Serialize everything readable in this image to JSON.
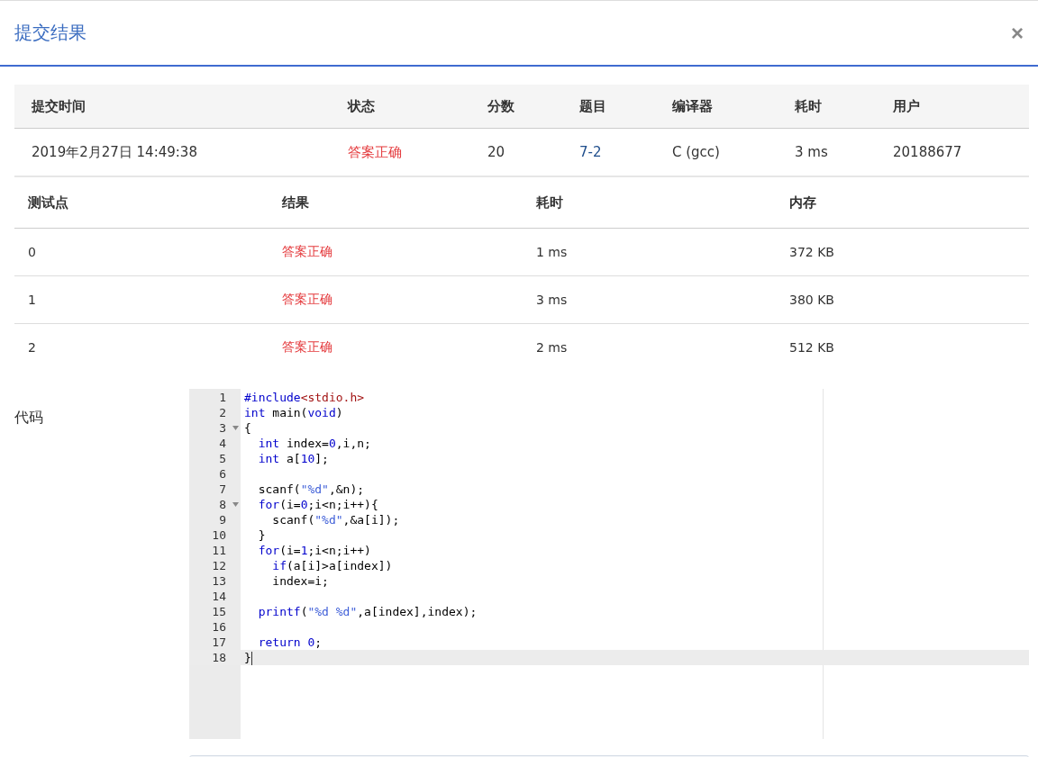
{
  "dialog": {
    "title": "提交结果",
    "close": "×"
  },
  "submission": {
    "columns": [
      "提交时间",
      "状态",
      "分数",
      "题目",
      "编译器",
      "耗时",
      "用户"
    ],
    "row": {
      "time": "2019年2月27日 14:49:38",
      "status": "答案正确",
      "score": "20",
      "problem": "7-2",
      "compiler": "C (gcc)",
      "duration": "3 ms",
      "user": "20188677"
    }
  },
  "tests": {
    "columns": [
      "测试点",
      "结果",
      "耗时",
      "内存"
    ],
    "rows": [
      {
        "case": "0",
        "result": "答案正确",
        "duration": "1 ms",
        "memory": "372 KB"
      },
      {
        "case": "1",
        "result": "答案正确",
        "duration": "3 ms",
        "memory": "380 KB"
      },
      {
        "case": "2",
        "result": "答案正确",
        "duration": "2 ms",
        "memory": "512 KB"
      }
    ]
  },
  "code": {
    "label": "代码",
    "lines": [
      {
        "number": "1",
        "foldable": false,
        "selected": false,
        "tokens": [
          {
            "kind": "keyword",
            "text": "#include"
          },
          {
            "kind": "header",
            "text": "<stdio.h>"
          }
        ]
      },
      {
        "number": "2",
        "foldable": false,
        "selected": false,
        "tokens": [
          {
            "kind": "keyword",
            "text": "int"
          },
          {
            "kind": "plain",
            "text": " main("
          },
          {
            "kind": "keyword",
            "text": "void"
          },
          {
            "kind": "plain",
            "text": ")"
          }
        ]
      },
      {
        "number": "3",
        "foldable": true,
        "selected": false,
        "tokens": [
          {
            "kind": "plain",
            "text": "{"
          }
        ]
      },
      {
        "number": "4",
        "foldable": false,
        "selected": false,
        "tokens": [
          {
            "kind": "keyword",
            "text": "  int"
          },
          {
            "kind": "plain",
            "text": " index="
          },
          {
            "kind": "number",
            "text": "0"
          },
          {
            "kind": "plain",
            "text": ",i,n;"
          }
        ]
      },
      {
        "number": "5",
        "foldable": false,
        "selected": false,
        "tokens": [
          {
            "kind": "keyword",
            "text": "  int"
          },
          {
            "kind": "plain",
            "text": " a["
          },
          {
            "kind": "number",
            "text": "10"
          },
          {
            "kind": "plain",
            "text": "];"
          }
        ]
      },
      {
        "number": "6",
        "foldable": false,
        "selected": false
      },
      {
        "number": "7",
        "foldable": false,
        "selected": false,
        "tokens": [
          {
            "kind": "plain",
            "text": "  scanf("
          },
          {
            "kind": "string",
            "text": "\"%d\""
          },
          {
            "kind": "plain",
            "text": ",&n);"
          }
        ]
      },
      {
        "number": "8",
        "foldable": true,
        "selected": false,
        "tokens": [
          {
            "kind": "keyword",
            "text": "  for"
          },
          {
            "kind": "plain",
            "text": "(i="
          },
          {
            "kind": "number",
            "text": "0"
          },
          {
            "kind": "plain",
            "text": ";i<n;i++){"
          }
        ]
      },
      {
        "number": "9",
        "foldable": false,
        "selected": false,
        "tokens": [
          {
            "kind": "plain",
            "text": "    scanf("
          },
          {
            "kind": "string",
            "text": "\"%d\""
          },
          {
            "kind": "plain",
            "text": ",&a[i]);"
          }
        ]
      },
      {
        "number": "10",
        "foldable": false,
        "selected": false,
        "tokens": [
          {
            "kind": "plain",
            "text": "  }"
          }
        ]
      },
      {
        "number": "11",
        "foldable": false,
        "selected": false,
        "tokens": [
          {
            "kind": "keyword",
            "text": "  for"
          },
          {
            "kind": "plain",
            "text": "(i="
          },
          {
            "kind": "number",
            "text": "1"
          },
          {
            "kind": "plain",
            "text": ";i<n;i++)"
          }
        ]
      },
      {
        "number": "12",
        "foldable": false,
        "selected": false,
        "tokens": [
          {
            "kind": "keyword",
            "text": "    if"
          },
          {
            "kind": "plain",
            "text": "(a[i]>a[index])"
          }
        ]
      },
      {
        "number": "13",
        "foldable": false,
        "selected": false,
        "tokens": [
          {
            "kind": "plain",
            "text": "    index=i;"
          }
        ]
      },
      {
        "number": "14",
        "foldable": false,
        "selected": false
      },
      {
        "number": "15",
        "foldable": false,
        "selected": false,
        "tokens": [
          {
            "kind": "keyword",
            "text": "  printf"
          },
          {
            "kind": "plain",
            "text": "("
          },
          {
            "kind": "string",
            "text": "\"%d %d\""
          },
          {
            "kind": "plain",
            "text": ",a[index],index);"
          }
        ]
      },
      {
        "number": "16",
        "foldable": false,
        "selected": false
      },
      {
        "number": "17",
        "foldable": false,
        "selected": false,
        "tokens": [
          {
            "kind": "keyword",
            "text": "  return"
          },
          {
            "kind": "number",
            "text": " 0"
          },
          {
            "kind": "plain",
            "text": ";"
          }
        ]
      },
      {
        "number": "18",
        "foldable": false,
        "selected": true,
        "tokens": [
          {
            "kind": "plain",
            "text": "}"
          }
        ]
      }
    ]
  }
}
